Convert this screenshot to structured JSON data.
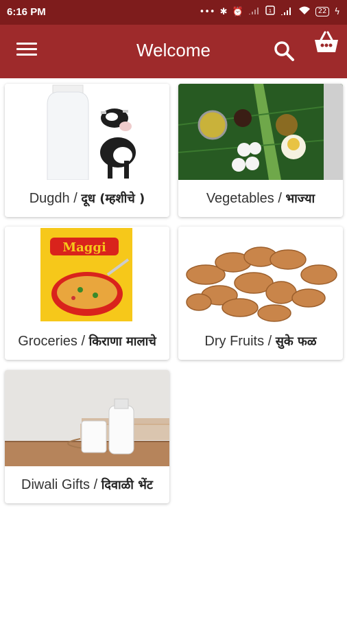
{
  "status_bar": {
    "time": "6:16 PM",
    "icons": [
      "dots-icon",
      "bluetooth-icon",
      "alarm-icon",
      "signal-icon",
      "sim-icon",
      "signal-4g-icon",
      "wifi-icon",
      "battery-icon",
      "charging-icon"
    ],
    "battery_level": "22"
  },
  "app_bar": {
    "title": "Welcome",
    "menu_icon": "hamburger-menu-icon",
    "search_icon": "search-icon",
    "cart_icon": "basket-icon",
    "background_color": "#9e2a2b",
    "status_bar_color": "#7e1c1c"
  },
  "categories": [
    {
      "name_en": "Dugdh / ",
      "name_mr": "दूध (म्हशीचे )",
      "image": "milk-bottle-and-cow-image"
    },
    {
      "name_en": "Vegetables / ",
      "name_mr": "भाज्या",
      "image": "vegetables-on-banana-leaf-image"
    },
    {
      "name_en": "Groceries / ",
      "name_mr": "किराणा मालाचे",
      "image": "maggi-noodles-pack-image",
      "brand_text": "Maggi"
    },
    {
      "name_en": "Dry Fruits / ",
      "name_mr": "सुके फळ",
      "image": "dry-dates-image"
    },
    {
      "name_en": "Diwali Gifts / ",
      "name_mr": "दिवाळी भेंट",
      "image": "milk-glass-and-bottle-image"
    }
  ]
}
